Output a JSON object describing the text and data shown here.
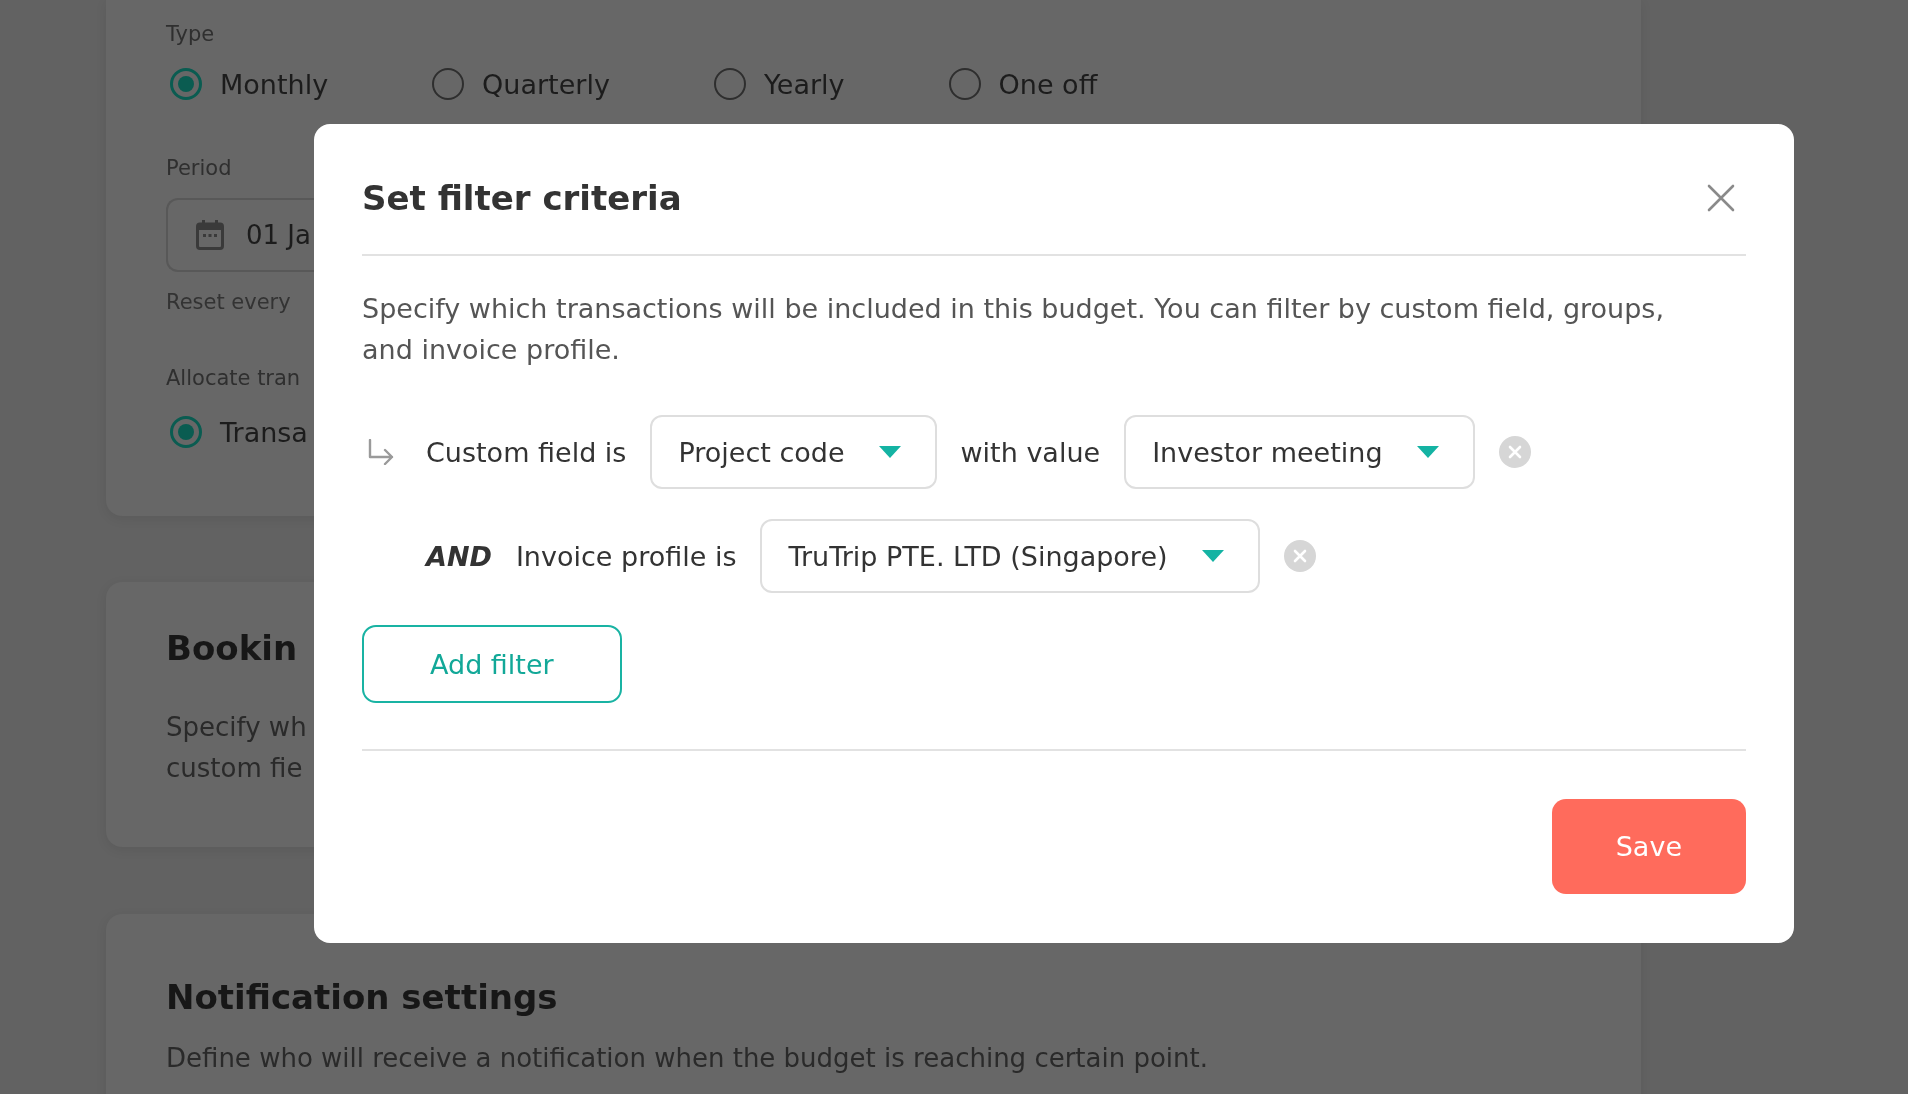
{
  "background": {
    "type": {
      "label": "Type",
      "options": [
        {
          "label": "Monthly",
          "selected": true
        },
        {
          "label": "Quarterly",
          "selected": false
        },
        {
          "label": "Yearly",
          "selected": false
        },
        {
          "label": "One off",
          "selected": false
        }
      ]
    },
    "period": {
      "label": "Period",
      "value": "01 Ja",
      "hint": "Reset every"
    },
    "allocate": {
      "label": "Allocate tran",
      "options": [
        {
          "label": "Transa",
          "selected": true
        }
      ]
    },
    "sections": [
      {
        "title": "Bookin",
        "description_lines": [
          "Specify wh",
          "custom fie"
        ]
      },
      {
        "title": "Notification settings",
        "description_lines": [
          "Define who will receive a notification when the budget is reaching certain point."
        ]
      }
    ]
  },
  "modal": {
    "title": "Set filter criteria",
    "description": "Specify which transactions will be included in this budget. You can filter by custom field, groups, and invoice profile.",
    "filters": [
      {
        "kind": "first",
        "label": "Custom field is",
        "field": "Project code",
        "value_label": "with value",
        "value": "Investor meeting"
      },
      {
        "kind": "and",
        "connector": "AND",
        "label": "Invoice profile is",
        "field": "TruTrip PTE. LTD (Singapore)"
      }
    ],
    "add_button": "Add filter",
    "save_button": "Save"
  }
}
